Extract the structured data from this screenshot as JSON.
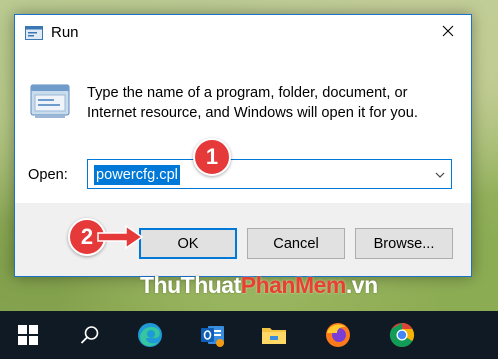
{
  "window": {
    "title": "Run",
    "description_line1": "Type the name of a program, folder, document, or",
    "description_line2": "Internet resource, and Windows will open it for you.",
    "open_label": "Open:",
    "open_value": "powercfg.cpl"
  },
  "buttons": {
    "ok": "OK",
    "cancel": "Cancel",
    "browse": "Browse..."
  },
  "annotations": {
    "step1": "1",
    "step2": "2",
    "badge_color": "#e5393a"
  },
  "watermark": {
    "part1": "ThuThuat",
    "part2": "PhanMem",
    "part3": ".vn"
  },
  "taskbar": {
    "items": [
      "windows-start-icon",
      "search-icon",
      "edge-icon",
      "outlook-icon",
      "file-explorer-icon",
      "firefox-icon",
      "chrome-icon"
    ]
  },
  "colors": {
    "accent": "#0078d7",
    "taskbar": "#101a24"
  }
}
